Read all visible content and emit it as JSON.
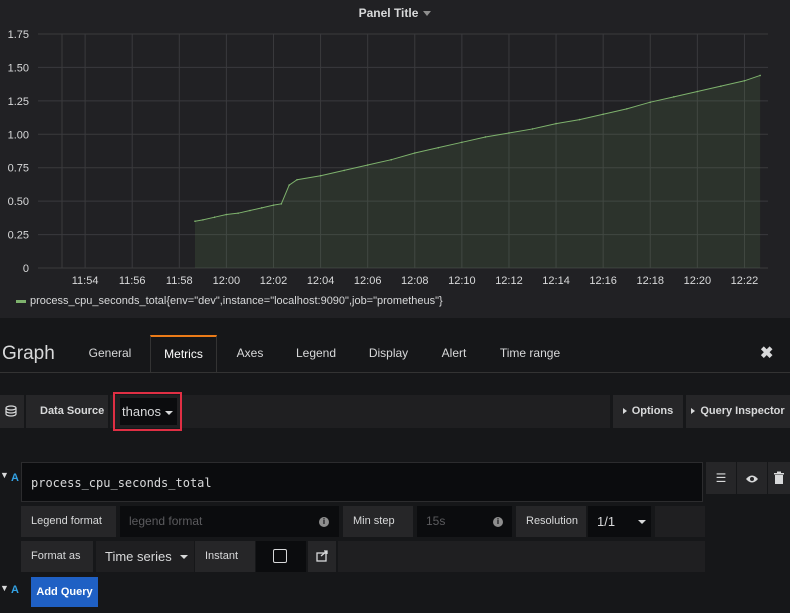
{
  "panel": {
    "title": "Panel Title"
  },
  "legend": {
    "series_label": "process_cpu_seconds_total{env=\"dev\",instance=\"localhost:9090\",job=\"prometheus\"}",
    "color": "#7eb26d"
  },
  "chart_data": {
    "type": "area",
    "title": "Panel Title",
    "xlabel": "",
    "ylabel": "",
    "ylim": [
      0,
      1.75
    ],
    "y_ticks": [
      "0",
      "0.25",
      "0.50",
      "0.75",
      "1.00",
      "1.25",
      "1.50",
      "1.75"
    ],
    "x_ticks": [
      "11:54",
      "11:56",
      "11:58",
      "12:00",
      "12:02",
      "12:04",
      "12:06",
      "12:08",
      "12:10",
      "12:12",
      "12:14",
      "12:16",
      "12:18",
      "12:20",
      "12:22"
    ],
    "grid": true,
    "legend_position": "bottom-left",
    "series": [
      {
        "name": "process_cpu_seconds_total{env=\"dev\",instance=\"localhost:9090\",job=\"prometheus\"}",
        "x": [
          "11:58:40",
          "11:59:00",
          "11:59:30",
          "12:00:00",
          "12:00:30",
          "12:01:00",
          "12:01:30",
          "12:02:00",
          "12:02:20",
          "12:02:40",
          "12:03:00",
          "12:04:00",
          "12:05:00",
          "12:06:00",
          "12:07:00",
          "12:08:00",
          "12:09:00",
          "12:10:00",
          "12:11:00",
          "12:12:00",
          "12:13:00",
          "12:14:00",
          "12:15:00",
          "12:16:00",
          "12:17:00",
          "12:18:00",
          "12:19:00",
          "12:20:00",
          "12:21:00",
          "12:22:00",
          "12:22:40"
        ],
        "values": [
          0.35,
          0.36,
          0.38,
          0.4,
          0.41,
          0.43,
          0.45,
          0.47,
          0.48,
          0.62,
          0.66,
          0.69,
          0.73,
          0.77,
          0.81,
          0.86,
          0.9,
          0.94,
          0.98,
          1.01,
          1.04,
          1.08,
          1.11,
          1.15,
          1.19,
          1.24,
          1.28,
          1.32,
          1.36,
          1.4,
          1.44
        ]
      }
    ]
  },
  "editor": {
    "title": "Graph",
    "tabs": [
      "General",
      "Metrics",
      "Axes",
      "Legend",
      "Display",
      "Alert",
      "Time range"
    ],
    "active_tab": "Metrics"
  },
  "datasource": {
    "label": "Data Source",
    "value": "thanos",
    "options_label": "Options",
    "inspector_label": "Query Inspector"
  },
  "query": {
    "ref": "A",
    "expr": "process_cpu_seconds_total",
    "legend_format_label": "Legend format",
    "legend_format_placeholder": "legend format",
    "min_step_label": "Min step",
    "min_step_placeholder": "15s",
    "resolution_label": "Resolution",
    "resolution_value": "1/1",
    "format_as_label": "Format as",
    "format_as_value": "Time series",
    "instant_label": "Instant"
  },
  "add_query": {
    "ref": "A",
    "label": "Add Query"
  }
}
